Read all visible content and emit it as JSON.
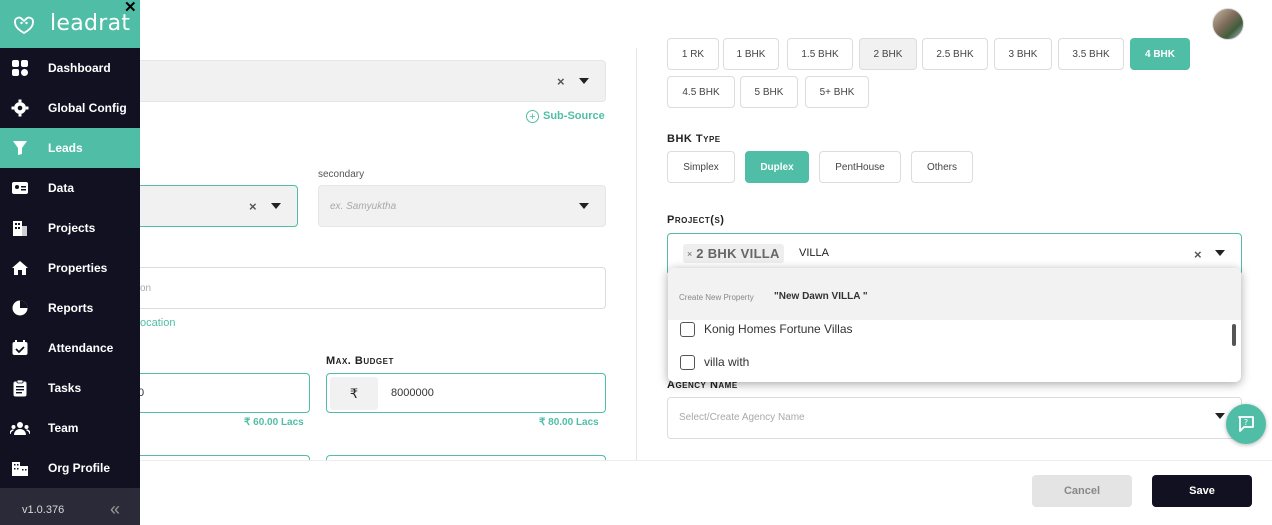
{
  "brand": {
    "name": "leadrat",
    "close_glyph": "✕"
  },
  "nav": [
    {
      "label": "Dashboard",
      "icon": "grid-icon"
    },
    {
      "label": "Global Config",
      "icon": "gear-icon"
    },
    {
      "label": "Leads",
      "icon": "funnel-icon",
      "active": true
    },
    {
      "label": "Data",
      "icon": "id-card-icon"
    },
    {
      "label": "Projects",
      "icon": "building-icon"
    },
    {
      "label": "Properties",
      "icon": "home-icon"
    },
    {
      "label": "Reports",
      "icon": "pie-chart-icon"
    },
    {
      "label": "Attendance",
      "icon": "calendar-icon"
    },
    {
      "label": "Tasks",
      "icon": "clipboard-icon"
    },
    {
      "label": "Team",
      "icon": "team-icon"
    },
    {
      "label": "Org Profile",
      "icon": "org-icon"
    }
  ],
  "footer": {
    "version": "v1.0.376",
    "collapse_glyph": "«"
  },
  "left_form": {
    "sub_source_link": "Sub-Source",
    "secondary_label": "secondary",
    "secondary_placeholder": "ex. Samyuktha",
    "location_placeholder": "on",
    "location_link": "ocation",
    "max_budget_label": "Max. Budget",
    "min_budget_value": "0",
    "min_budget_hint": "₹ 60.00 Lacs",
    "currency_symbol": "₹",
    "max_budget_value": "8000000",
    "max_budget_hint": "₹ 80.00 Lacs",
    "clear_glyph": "×"
  },
  "bhk_options": [
    "1 RK",
    "1 BHK",
    "1.5 BHK",
    "2 BHK",
    "2.5 BHK",
    "3 BHK",
    "3.5 BHK",
    "4 BHK",
    "4.5 BHK",
    "5 BHK",
    "5+ BHK"
  ],
  "bhk_selected": "4 BHK",
  "bhk_type": {
    "label": "BHK Type",
    "options": [
      "Simplex",
      "Duplex",
      "PentHouse",
      "Others"
    ],
    "selected": "Duplex"
  },
  "projects": {
    "label": "Project(s)",
    "tag_remove_glyph": "×",
    "tag": "2 BHK VILLA",
    "search_text": "VILLA",
    "clear_glyph": "×"
  },
  "dropdown": {
    "create_hint": "Create New Property",
    "create_value": "\"New Dawn VILLA \"",
    "options": [
      "Konig Homes Fortune Villas",
      "villa with"
    ]
  },
  "agency": {
    "label": "Agency Name",
    "placeholder": "Select/Create Agency Name"
  },
  "actions": {
    "cancel": "Cancel",
    "save": "Save"
  },
  "colors": {
    "accent": "#50bea7",
    "sidebar": "#121121"
  }
}
